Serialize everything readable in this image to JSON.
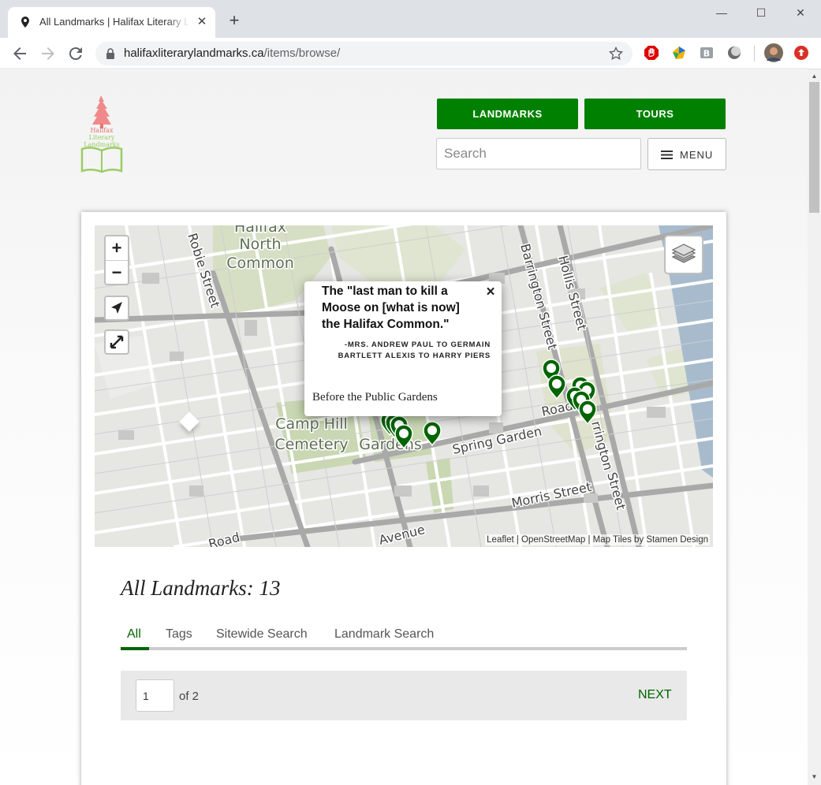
{
  "browser": {
    "tab_title": "All Landmarks | Halifax Literary Landmarks",
    "new_tab": "+",
    "url_domain": "halifaxliterarylandmarks.ca",
    "url_path": "/items/browse/"
  },
  "header": {
    "logo_text": [
      "Halifax",
      "Literary",
      "Landmarks"
    ],
    "nav_landmarks": "LANDMARKS",
    "nav_tours": "TOURS",
    "search_placeholder": "Search",
    "menu_label": "MENU"
  },
  "map": {
    "zoom_in": "+",
    "zoom_out": "−",
    "attribution": "Leaflet | OpenStreetMap | Map Tiles by Stamen Design",
    "labels": {
      "north_common": "North",
      "north_common2": "Common",
      "halifax": "Halifax",
      "camp_hill": "Camp Hill",
      "cemetery": "Cemetery",
      "gardens": "Gardens",
      "spring_garden": "Spring Garden",
      "road": "Road",
      "morris": "Morris Street",
      "barrington": "Barrington Street",
      "hollis": "Hollis Street",
      "robie": "Robie Street",
      "avenue": "Avenue",
      "road_left": "Road",
      "barrington2": "rrington",
      "street_right": "Street"
    },
    "popup": {
      "quote": "The \"last man to kill a Moose on [what is now] the Halifax Common.\"",
      "attribution": "-MRS. ANDREW PAUL TO GERMAIN BARTLETT ALEXIS TO HARRY PIERS",
      "caption": "Before the Public Gardens",
      "close": "×"
    },
    "marker_color": "#006400"
  },
  "listing": {
    "heading": "All Landmarks: 13",
    "tabs": [
      "All",
      "Tags",
      "Sitewide Search",
      "Landmark Search"
    ],
    "active_tab": "All",
    "page_value": "1",
    "page_of": "of 2",
    "next": "NEXT"
  },
  "colors": {
    "brand_green": "#008000",
    "link_green": "#006400"
  }
}
